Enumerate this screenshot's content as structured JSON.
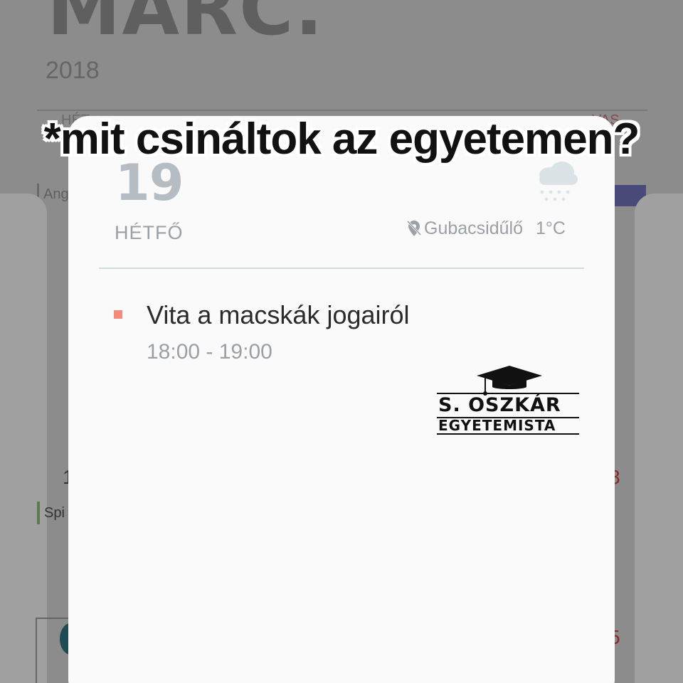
{
  "background_calendar": {
    "month": "MÁRC.",
    "year": "2018",
    "weekday_header_left": "HÉT",
    "weekday_header_right": "VAS",
    "event_left_top": "Ang",
    "day_number_left": "1",
    "day_number_right": "8",
    "event_left_mid": "Spi",
    "day_number_right_bottom": "5"
  },
  "caption": "*mit csináltok az egyetemen?",
  "day_popup": {
    "day_number": "19",
    "day_name": "HÉTFŐ",
    "weather_icon": "snow-cloud-icon",
    "location": "Gubacsidűlő",
    "temperature": "1°C",
    "events": [
      {
        "title": "Vita a macskák jogairól",
        "time": "18:00 - 19:00",
        "color": "#f28c7a"
      }
    ]
  },
  "logo": {
    "name": "S. OSZKÁR",
    "subtitle": "EGYETEMISTA",
    "icon": "graduation-cap-icon"
  },
  "colors": {
    "dim_background": "#8c8c8c",
    "card_background": "#fafafa",
    "event_bullet": "#f28c7a",
    "muted_text": "#9aa0a6"
  }
}
